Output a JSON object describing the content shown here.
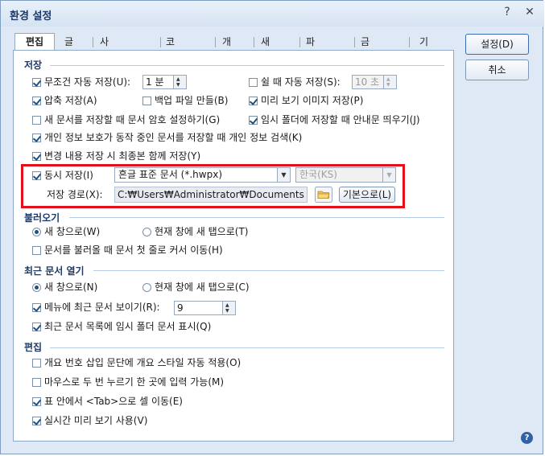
{
  "window": {
    "title": "환경 설정",
    "help_glyph": "?",
    "close_glyph": "✕"
  },
  "tabs": [
    "편집",
    "글꼴",
    "사용자 정보",
    "코드 형식",
    "개체",
    "새 문서",
    "파일 위치",
    "금칙 처리",
    "기타"
  ],
  "buttons": {
    "ok": "설정(D)",
    "cancel": "취소"
  },
  "save_section": {
    "title": "저장",
    "auto_save_label": "무조건 자동 저장(U):",
    "auto_save_checked": true,
    "auto_save_value": "1 분",
    "idle_save_label": "쉴 때 자동 저장(S):",
    "idle_save_checked": false,
    "idle_save_value": "10 초",
    "compress_label": "압축 저장(A)",
    "backup_label": "백업 파일 만들(B)",
    "preview_label": "미리 보기 이미지 저장(P)",
    "password_label": "새 문서를 저장할 때 문서 암호 설정하기(G)",
    "temp_notice_label": "임시 폴더에 저장할 때 안내문 띄우기(J)",
    "privacy_label": "개인 정보 보호가 동작 중인 문서를 저장할 때 개인 정보 검색(K)",
    "final_label": "변경 내용 저장 시 최종본 함께 저장(Y)",
    "simul_label": "동시 저장(I)",
    "simul_format": "흔글 표준 문서 (*.hwpx)",
    "simul_lang": "한국(KS)",
    "path_label": "저장 경로(X):",
    "path_value": "C:₩Users₩Administrator₩Documents",
    "default_button": "기본으로(L)"
  },
  "open_section": {
    "title": "불러오기",
    "new_tab_label": "새 창으로(W)",
    "current_tab_label": "현재 창에 새 탭으로(T)",
    "scroll_label": "문서를 불러올 때 문서 첫 줄로 커서 이동(H)"
  },
  "recent_section": {
    "title": "최근 문서 열기",
    "new_window_label": "새 창으로(N)",
    "current_window_label": "현재 창에 새 탭으로(C)",
    "menu_show_label": "메뉴에 최근 문서 보이기(R):",
    "menu_show_value": "9",
    "temp_list_label": "최근 문서 목록에 임시 폴더 문서 표시(Q)"
  },
  "edit_section": {
    "title": "편집",
    "outline_label": "개요 번호 삽입 문단에 개요 스타일 자동 적용(O)",
    "dblclick_label": "마우스로 두 번 누르기 한 곳에 입력 가능(M)",
    "tab_cell_label": "표 안에서 <Tab>으로 셀 이동(E)",
    "live_preview_label": "실시간 미리 보기 사용(V)"
  },
  "colors": {
    "accent": "#1e3a66",
    "highlight_box": "#e3101c",
    "dialog_bg": "#dfe9f5"
  },
  "icons": {
    "help": "help-icon",
    "folder": "folder-icon",
    "close": "close-icon"
  }
}
